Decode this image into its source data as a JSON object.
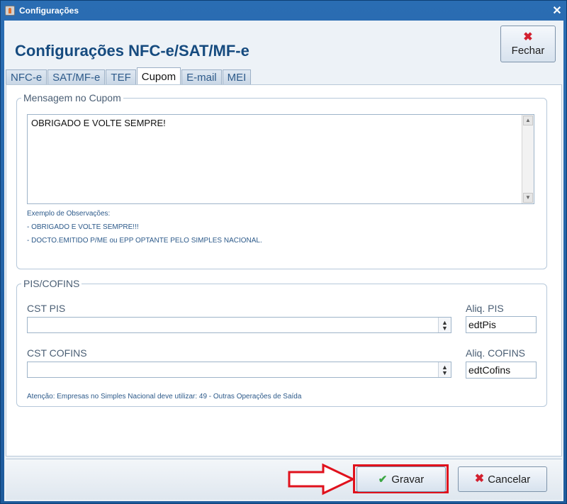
{
  "window": {
    "title": "Configurações",
    "close_glyph": "✕"
  },
  "header": {
    "title": "Configurações NFC-e/SAT/MF-e"
  },
  "buttons": {
    "fechar": {
      "label": "Fechar",
      "icon": "x-icon"
    },
    "gravar": {
      "label": "Gravar",
      "icon": "check-icon"
    },
    "cancelar": {
      "label": "Cancelar",
      "icon": "x-icon"
    }
  },
  "tabs": [
    {
      "label": "NFC-e",
      "active": false
    },
    {
      "label": "SAT/MF-e",
      "active": false
    },
    {
      "label": "TEF",
      "active": false
    },
    {
      "label": "Cupom",
      "active": true
    },
    {
      "label": "E-mail",
      "active": false
    },
    {
      "label": "MEI",
      "active": false
    }
  ],
  "cupom": {
    "group_title": "Mensagem no Cupom",
    "memo_value": "OBRIGADO E VOLTE SEMPRE!",
    "hint_title": "Exemplo de Observações:",
    "hint_line1": "- OBRIGADO E VOLTE SEMPRE!!!",
    "hint_line2": "- DOCTO.EMITIDO P/ME ou EPP OPTANTE PELO SIMPLES NACIONAL."
  },
  "pis_cofins": {
    "group_title": "PIS/COFINS",
    "cst_pis_label": "CST PIS",
    "cst_pis_value": "",
    "aliq_pis_label": "Aliq. PIS",
    "aliq_pis_value": "edtPis",
    "cst_cofins_label": "CST COFINS",
    "cst_cofins_value": "",
    "aliq_cofins_label": "Aliq. COFINS",
    "aliq_cofins_value": "edtCofins",
    "note": "Atenção: Empresas no Simples Nacional deve utilizar: 49 - Outras Operações de Saída"
  },
  "colors": {
    "title_blue": "#164b7f",
    "highlight_red": "#e0111c",
    "frame_blue": "#1e5b9c"
  }
}
